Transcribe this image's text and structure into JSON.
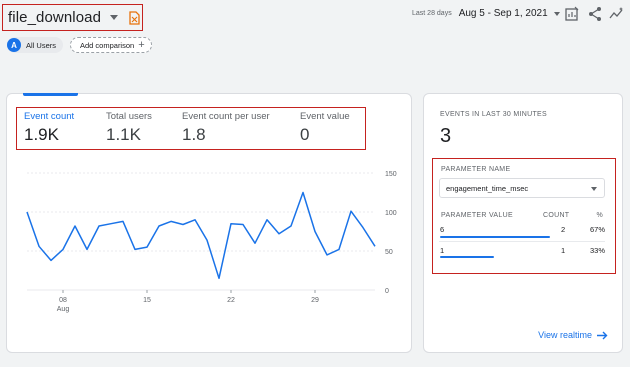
{
  "header": {
    "event_name": "file_download",
    "date_preset": "Last 28 days",
    "date_range": "Aug 5 - Sep 1, 2021",
    "icons": [
      "doc-icon",
      "customize-report-icon",
      "share-icon",
      "insights-icon"
    ]
  },
  "comparisons": {
    "segment_badge": "A",
    "segment_label": "All Users",
    "add_label": "Add comparison"
  },
  "metrics": [
    {
      "label": "Event count",
      "value": "1.9K",
      "active": true
    },
    {
      "label": "Total users",
      "value": "1.1K",
      "active": false
    },
    {
      "label": "Event count per user",
      "value": "1.8",
      "active": false
    },
    {
      "label": "Event value",
      "value": "0",
      "active": false
    }
  ],
  "chart_data": {
    "type": "line",
    "x_ticks": [
      {
        "label": "08",
        "sublabel": "Aug",
        "day": 3
      },
      {
        "label": "15",
        "day": 10
      },
      {
        "label": "22",
        "day": 17
      },
      {
        "label": "29",
        "day": 24
      }
    ],
    "y_ticks": [
      150,
      100,
      50,
      0
    ],
    "ylim": [
      0,
      150
    ],
    "values": [
      100,
      56,
      38,
      52,
      82,
      52,
      82,
      85,
      88,
      52,
      55,
      82,
      88,
      84,
      90,
      64,
      15,
      85,
      84,
      60,
      90,
      72,
      82,
      125,
      75,
      45,
      52,
      101,
      80,
      56
    ],
    "color": "#1a73e8",
    "grid": true
  },
  "realtime": {
    "title": "EVENTS IN LAST 30 MINUTES",
    "value": "3",
    "param_label": "PARAMETER NAME",
    "param_selected": "engagement_time_msec",
    "columns": [
      "PARAMETER VALUE",
      "COUNT",
      "%"
    ],
    "rows": [
      {
        "value": "6",
        "count": "2",
        "pct": "67%",
        "share": 0.67
      },
      {
        "value": "1",
        "count": "1",
        "pct": "33%",
        "share": 0.33
      }
    ],
    "link_label": "View realtime"
  }
}
